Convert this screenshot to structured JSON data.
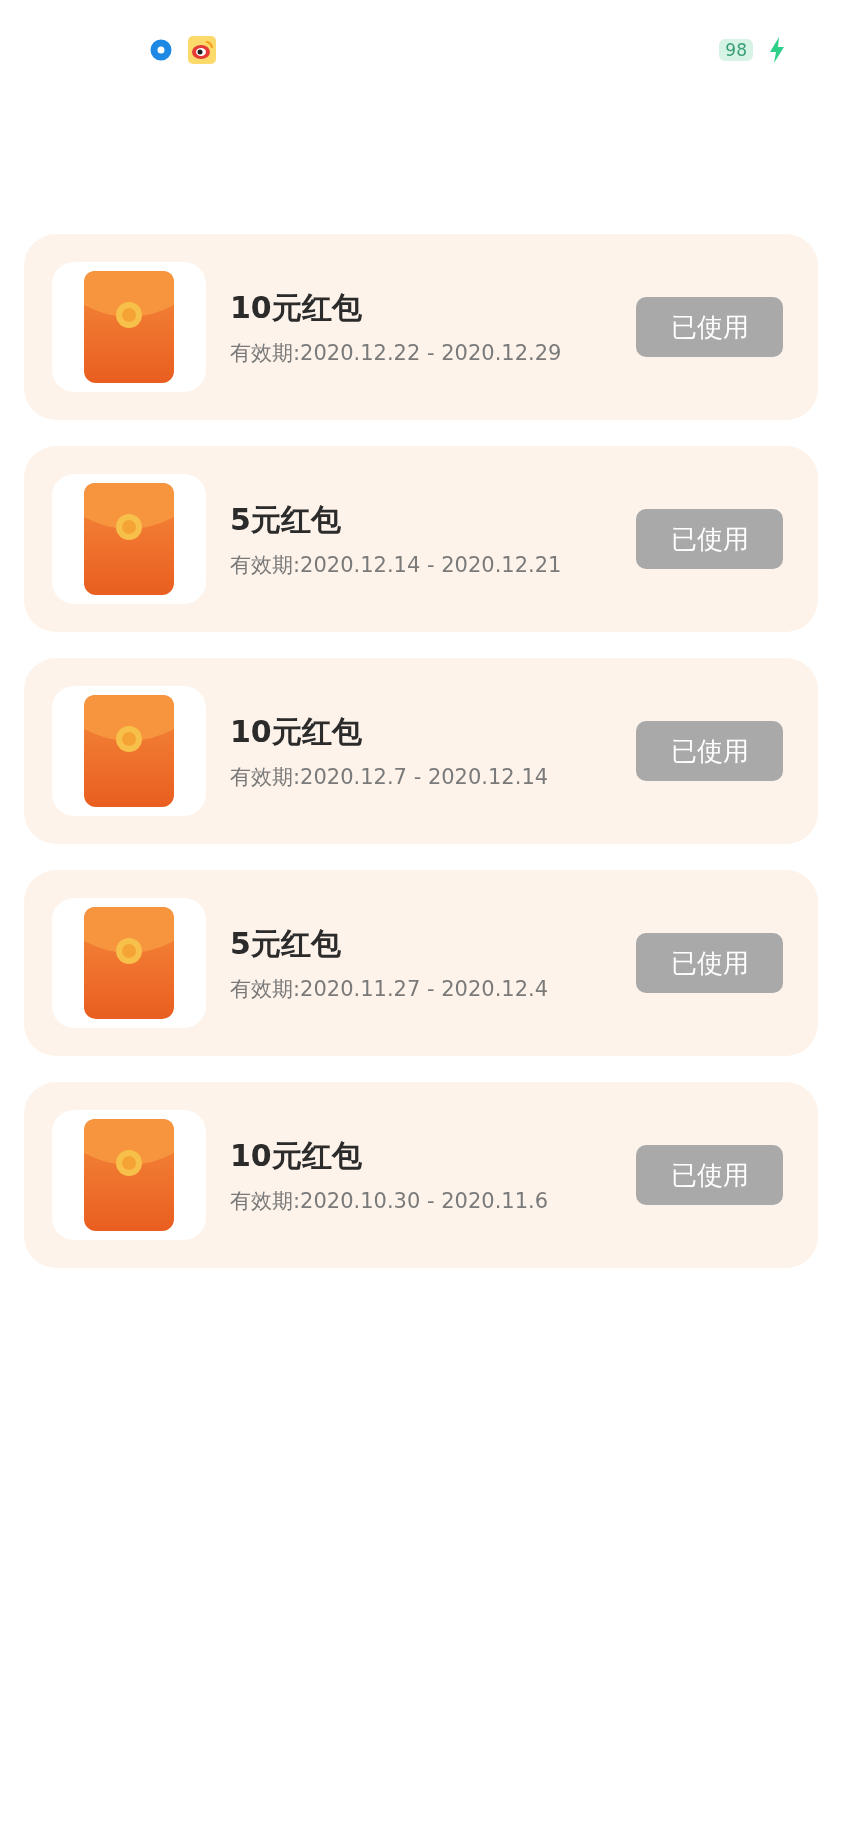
{
  "status_bar": {
    "battery": "98",
    "charging": true
  },
  "coupons": [
    {
      "title": "10元红包",
      "validity": "有效期:2020.12.22 - 2020.12.29",
      "action": "已使用",
      "disabled": true
    },
    {
      "title": "5元红包",
      "validity": "有效期:2020.12.14 - 2020.12.21",
      "action": "已使用",
      "disabled": true
    },
    {
      "title": "10元红包",
      "validity": "有效期:2020.12.7 - 2020.12.14",
      "action": "已使用",
      "disabled": true
    },
    {
      "title": "5元红包",
      "validity": "有效期:2020.11.27 - 2020.12.4",
      "action": "已使用",
      "disabled": true
    },
    {
      "title": "10元红包",
      "validity": "有效期:2020.10.30 - 2020.11.6",
      "action": "已使用",
      "disabled": true
    }
  ]
}
